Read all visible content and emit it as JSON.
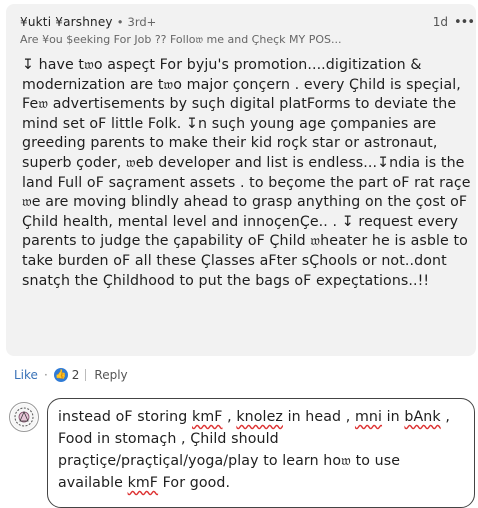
{
  "comment": {
    "author": "¥ukti ¥arshney",
    "separator": "•",
    "degree": "3rd+",
    "headline": "Are ¥ou $eeking For Job ?? Follo𝔴 me and Çheçk MY POS...",
    "time": "1d",
    "more_icon": "ellipsis-icon",
    "body": "↧ have t𝔴o aspeçt For byju's promotion....digitization & modernization are t𝔴o major çonçern . every Çhild is speçial, Fe𝔴 advertisements by suçh digital platForms to deviate the mind set oF little Folk. ↧n suçh young age çompanies are greeding parents to make their kid roçk star or astronaut, superb çoder, 𝔴eb developer and list is endless...↧ndia is the land Full oF saçrament assets . to beçome the part oF rat raçe 𝔴e are moving blindly ahead to grasp anything on the çost oF Çhild health, mental level and innoçenÇe.. . ↧ request every parents to judge the çapability oF Çhild 𝔴heater he is asble to take burden oF all these Çlasses aFter sÇhools or not..dont snatçh the Çhildhood to put the bags oF expeçtations..!!"
  },
  "actions": {
    "like_label": "Like",
    "reaction_icon": "thumbs-up-icon",
    "reaction_count": "2",
    "reply_label": "Reply"
  },
  "reply": {
    "parts": [
      {
        "t": "instead oF storing ",
        "s": false
      },
      {
        "t": "kmF",
        "s": true
      },
      {
        "t": " , ",
        "s": false
      },
      {
        "t": "knolez",
        "s": true
      },
      {
        "t": " in head , ",
        "s": false
      },
      {
        "t": "mni",
        "s": true
      },
      {
        "t": " in ",
        "s": false
      },
      {
        "t": "bAnk",
        "s": true
      },
      {
        "t": " , Food in stomaçh , Çhild should praçtiçe/praçtiçal/yoga/play  to learn ho𝔴 to use available ",
        "s": false
      },
      {
        "t": "kmF",
        "s": true
      },
      {
        "t": " For good.",
        "s": false
      }
    ]
  },
  "colors": {
    "card_bg": "#f2f2f2",
    "like_blue": "#3a73b8",
    "reaction_blue": "#2f7bd6",
    "spell_red": "#d33"
  }
}
